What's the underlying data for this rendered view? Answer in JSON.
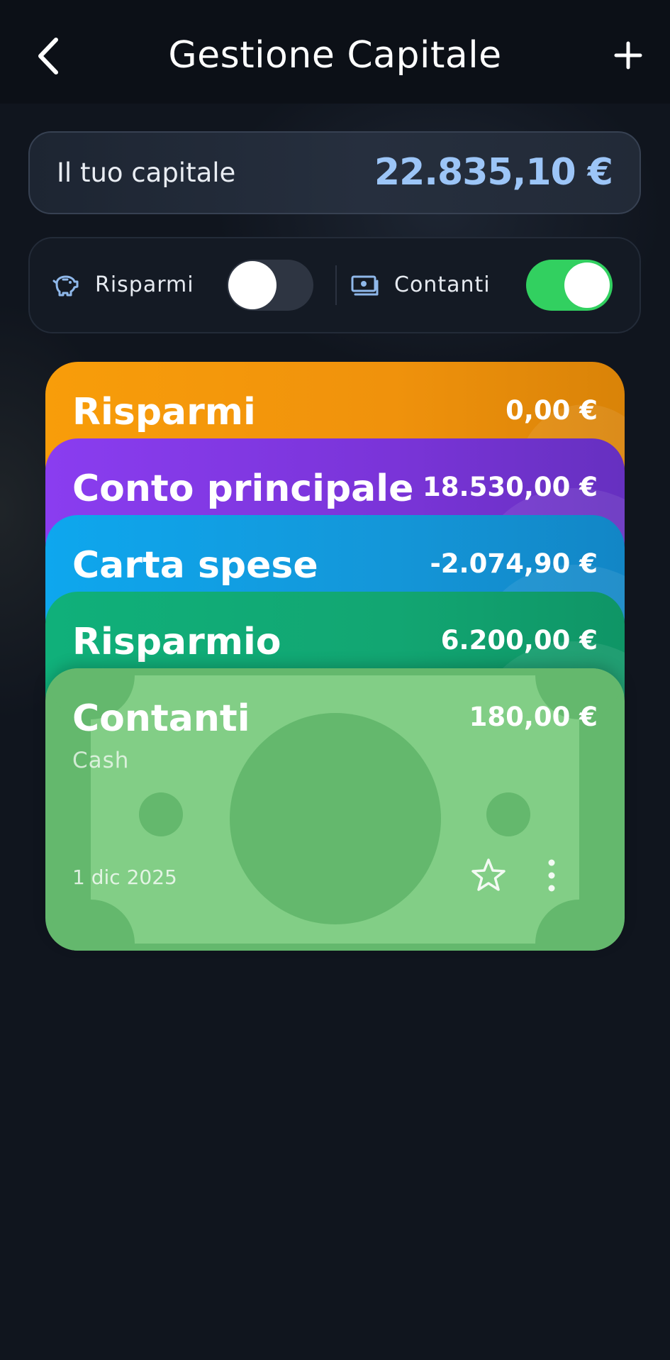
{
  "header": {
    "title": "Gestione Capitale",
    "back_icon": "chevron-left-icon",
    "add_icon": "plus-icon"
  },
  "capital": {
    "label": "Il tuo capitale",
    "value": "22.835,10 €",
    "value_color": "#9cc5f7"
  },
  "filters": {
    "savings": {
      "label": "Risparmi",
      "icon": "piggy-bank-icon",
      "enabled": false
    },
    "cash": {
      "label": "Contanti",
      "icon": "cash-icon",
      "enabled": true,
      "color": "#32d060"
    }
  },
  "cards": [
    {
      "name": "Risparmi",
      "amount": "0,00 €",
      "color": "#f89d0a"
    },
    {
      "name": "Conto principale",
      "amount": "18.530,00 €",
      "color": "#8a3df0"
    },
    {
      "name": "Carta spese",
      "amount": "-2.074,90 €",
      "color": "#0ea7ee"
    },
    {
      "name": "Risparmio",
      "amount": "6.200,00 €",
      "color": "#10b07a"
    },
    {
      "name": "Contanti",
      "amount": "180,00 €",
      "subtitle": "Cash",
      "date": "1 dic 2025",
      "color": "#64b86d",
      "favorite_icon": "star-icon",
      "menu_icon": "more-vertical-icon"
    }
  ]
}
